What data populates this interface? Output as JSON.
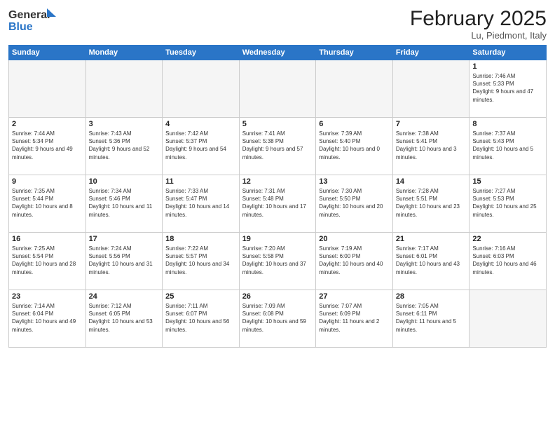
{
  "header": {
    "logo_line1": "General",
    "logo_line2": "Blue",
    "month": "February 2025",
    "location": "Lu, Piedmont, Italy"
  },
  "days_of_week": [
    "Sunday",
    "Monday",
    "Tuesday",
    "Wednesday",
    "Thursday",
    "Friday",
    "Saturday"
  ],
  "weeks": [
    [
      {
        "day": "",
        "info": ""
      },
      {
        "day": "",
        "info": ""
      },
      {
        "day": "",
        "info": ""
      },
      {
        "day": "",
        "info": ""
      },
      {
        "day": "",
        "info": ""
      },
      {
        "day": "",
        "info": ""
      },
      {
        "day": "1",
        "info": "Sunrise: 7:46 AM\nSunset: 5:33 PM\nDaylight: 9 hours and 47 minutes."
      }
    ],
    [
      {
        "day": "2",
        "info": "Sunrise: 7:44 AM\nSunset: 5:34 PM\nDaylight: 9 hours and 49 minutes."
      },
      {
        "day": "3",
        "info": "Sunrise: 7:43 AM\nSunset: 5:36 PM\nDaylight: 9 hours and 52 minutes."
      },
      {
        "day": "4",
        "info": "Sunrise: 7:42 AM\nSunset: 5:37 PM\nDaylight: 9 hours and 54 minutes."
      },
      {
        "day": "5",
        "info": "Sunrise: 7:41 AM\nSunset: 5:38 PM\nDaylight: 9 hours and 57 minutes."
      },
      {
        "day": "6",
        "info": "Sunrise: 7:39 AM\nSunset: 5:40 PM\nDaylight: 10 hours and 0 minutes."
      },
      {
        "day": "7",
        "info": "Sunrise: 7:38 AM\nSunset: 5:41 PM\nDaylight: 10 hours and 3 minutes."
      },
      {
        "day": "8",
        "info": "Sunrise: 7:37 AM\nSunset: 5:43 PM\nDaylight: 10 hours and 5 minutes."
      }
    ],
    [
      {
        "day": "9",
        "info": "Sunrise: 7:35 AM\nSunset: 5:44 PM\nDaylight: 10 hours and 8 minutes."
      },
      {
        "day": "10",
        "info": "Sunrise: 7:34 AM\nSunset: 5:46 PM\nDaylight: 10 hours and 11 minutes."
      },
      {
        "day": "11",
        "info": "Sunrise: 7:33 AM\nSunset: 5:47 PM\nDaylight: 10 hours and 14 minutes."
      },
      {
        "day": "12",
        "info": "Sunrise: 7:31 AM\nSunset: 5:48 PM\nDaylight: 10 hours and 17 minutes."
      },
      {
        "day": "13",
        "info": "Sunrise: 7:30 AM\nSunset: 5:50 PM\nDaylight: 10 hours and 20 minutes."
      },
      {
        "day": "14",
        "info": "Sunrise: 7:28 AM\nSunset: 5:51 PM\nDaylight: 10 hours and 23 minutes."
      },
      {
        "day": "15",
        "info": "Sunrise: 7:27 AM\nSunset: 5:53 PM\nDaylight: 10 hours and 25 minutes."
      }
    ],
    [
      {
        "day": "16",
        "info": "Sunrise: 7:25 AM\nSunset: 5:54 PM\nDaylight: 10 hours and 28 minutes."
      },
      {
        "day": "17",
        "info": "Sunrise: 7:24 AM\nSunset: 5:56 PM\nDaylight: 10 hours and 31 minutes."
      },
      {
        "day": "18",
        "info": "Sunrise: 7:22 AM\nSunset: 5:57 PM\nDaylight: 10 hours and 34 minutes."
      },
      {
        "day": "19",
        "info": "Sunrise: 7:20 AM\nSunset: 5:58 PM\nDaylight: 10 hours and 37 minutes."
      },
      {
        "day": "20",
        "info": "Sunrise: 7:19 AM\nSunset: 6:00 PM\nDaylight: 10 hours and 40 minutes."
      },
      {
        "day": "21",
        "info": "Sunrise: 7:17 AM\nSunset: 6:01 PM\nDaylight: 10 hours and 43 minutes."
      },
      {
        "day": "22",
        "info": "Sunrise: 7:16 AM\nSunset: 6:03 PM\nDaylight: 10 hours and 46 minutes."
      }
    ],
    [
      {
        "day": "23",
        "info": "Sunrise: 7:14 AM\nSunset: 6:04 PM\nDaylight: 10 hours and 49 minutes."
      },
      {
        "day": "24",
        "info": "Sunrise: 7:12 AM\nSunset: 6:05 PM\nDaylight: 10 hours and 53 minutes."
      },
      {
        "day": "25",
        "info": "Sunrise: 7:11 AM\nSunset: 6:07 PM\nDaylight: 10 hours and 56 minutes."
      },
      {
        "day": "26",
        "info": "Sunrise: 7:09 AM\nSunset: 6:08 PM\nDaylight: 10 hours and 59 minutes."
      },
      {
        "day": "27",
        "info": "Sunrise: 7:07 AM\nSunset: 6:09 PM\nDaylight: 11 hours and 2 minutes."
      },
      {
        "day": "28",
        "info": "Sunrise: 7:05 AM\nSunset: 6:11 PM\nDaylight: 11 hours and 5 minutes."
      },
      {
        "day": "",
        "info": ""
      }
    ]
  ]
}
